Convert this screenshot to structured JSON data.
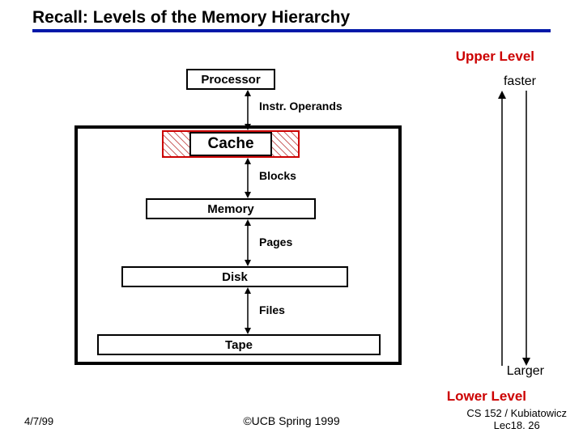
{
  "title": "Recall: Levels of the Memory Hierarchy",
  "upper_level": "Upper Level",
  "lower_level": "Lower Level",
  "faster": "faster",
  "larger": "Larger",
  "levels": {
    "processor": "Processor",
    "cache": "Cache",
    "memory": "Memory",
    "disk": "Disk",
    "tape": "Tape"
  },
  "transfers": {
    "instr_operands": "Instr. Operands",
    "blocks": "Blocks",
    "pages": "Pages",
    "files": "Files"
  },
  "footer": {
    "date": "4/7/99",
    "copyright": "©UCB Spring 1999",
    "course_line1": "CS 152 / Kubiatowicz",
    "course_line2": "Lec18. 26"
  }
}
